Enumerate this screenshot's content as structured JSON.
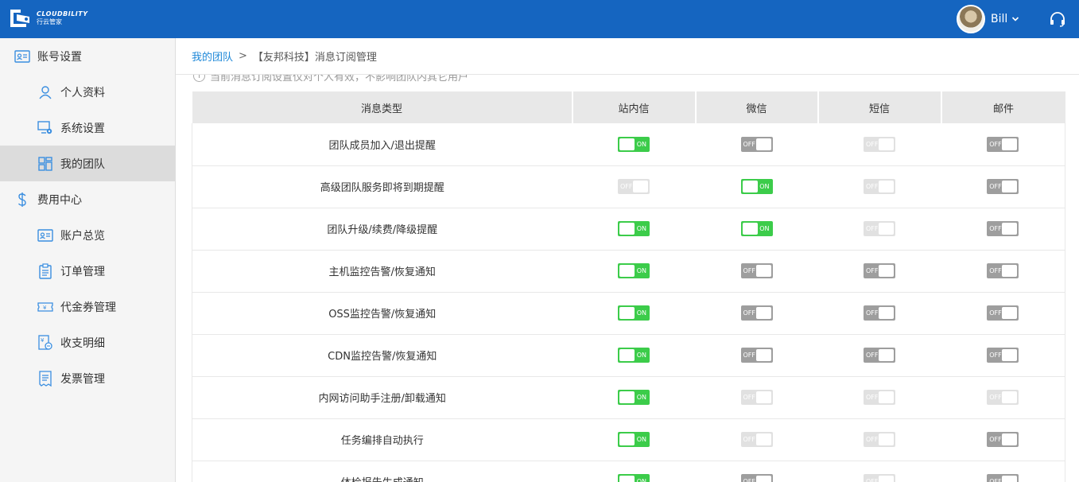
{
  "header": {
    "logo_en": "CLOUDBILITY",
    "logo_cn": "行云管家",
    "user_name": "Bill"
  },
  "sidebar": {
    "items": [
      {
        "label": "账号设置",
        "icon": "id-card-icon",
        "type": "group",
        "active": false
      },
      {
        "label": "个人资料",
        "icon": "person-icon",
        "type": "sub",
        "active": false
      },
      {
        "label": "系统设置",
        "icon": "monitor-gear-icon",
        "type": "sub",
        "active": false
      },
      {
        "label": "我的团队",
        "icon": "grid-icon",
        "type": "sub",
        "active": true
      },
      {
        "label": "费用中心",
        "icon": "dollar-icon",
        "type": "group",
        "active": false
      },
      {
        "label": "账户总览",
        "icon": "id-card-icon",
        "type": "sub",
        "active": false
      },
      {
        "label": "订单管理",
        "icon": "clipboard-icon",
        "type": "sub",
        "active": false
      },
      {
        "label": "代金券管理",
        "icon": "coupon-icon",
        "type": "sub",
        "active": false
      },
      {
        "label": "收支明细",
        "icon": "ledger-icon",
        "type": "sub",
        "active": false
      },
      {
        "label": "发票管理",
        "icon": "invoice-icon",
        "type": "sub",
        "active": false
      }
    ]
  },
  "breadcrumb": {
    "link": "我的团队",
    "separator": ">",
    "current": "【友邦科技】消息订阅管理"
  },
  "notice": "当前消息订阅设置仅对个人有效，不影响团队内其它用户",
  "table": {
    "headers": [
      "消息类型",
      "站内信",
      "微信",
      "短信",
      "邮件"
    ],
    "rows": [
      {
        "type": "团队成员加入/退出提醒",
        "states": [
          "on",
          "off",
          "disabled",
          "off"
        ]
      },
      {
        "type": "高级团队服务即将到期提醒",
        "states": [
          "disabled",
          "on",
          "disabled",
          "off"
        ]
      },
      {
        "type": "团队升级/续费/降级提醒",
        "states": [
          "on",
          "on",
          "disabled",
          "off"
        ]
      },
      {
        "type": "主机监控告警/恢复通知",
        "states": [
          "on",
          "off",
          "off",
          "off"
        ]
      },
      {
        "type": "OSS监控告警/恢复通知",
        "states": [
          "on",
          "off",
          "off",
          "off"
        ]
      },
      {
        "type": "CDN监控告警/恢复通知",
        "states": [
          "on",
          "off",
          "off",
          "off"
        ]
      },
      {
        "type": "内网访问助手注册/卸载通知",
        "states": [
          "on",
          "disabled",
          "disabled",
          "disabled"
        ]
      },
      {
        "type": "任务编排自动执行",
        "states": [
          "on",
          "disabled",
          "disabled",
          "off"
        ]
      },
      {
        "type": "体检报告生成通知",
        "states": [
          "on",
          "off",
          "disabled",
          "off"
        ]
      }
    ]
  },
  "toggle_labels": {
    "on": "ON",
    "off": "OFF"
  },
  "colors": {
    "header": "#1565c0",
    "toggle_on": "#3ccc4a",
    "toggle_off": "#9e9e9e",
    "link": "#1e88d8"
  }
}
